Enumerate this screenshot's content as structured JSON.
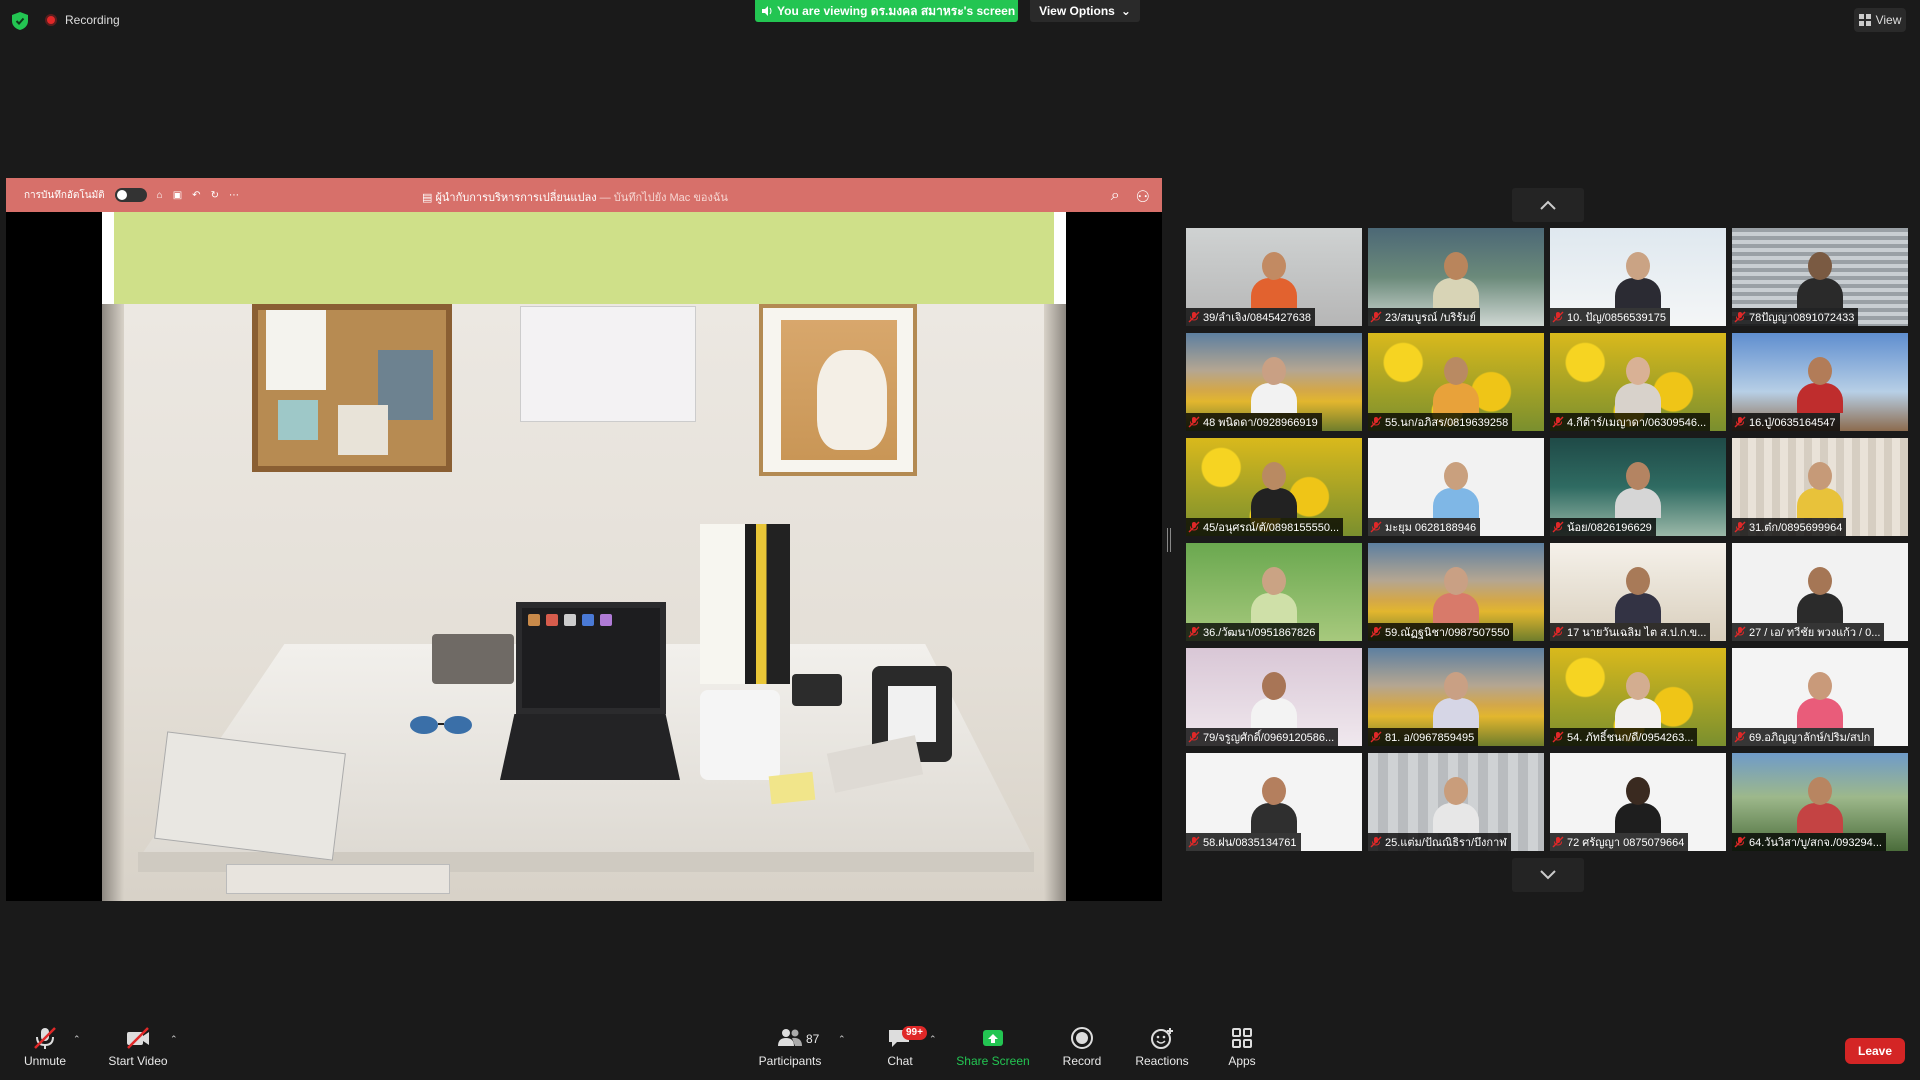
{
  "top": {
    "recording_label": "Recording",
    "banner_text": "You are viewing ดร.มงคล สมาหระ's screen",
    "view_options_label": "View Options",
    "view_label": "View"
  },
  "keynote": {
    "autosave_label": "การบันทึกอัตโนมัติ",
    "toggle_label": "ปิด",
    "document_title": "ผู้นำกับการบริหารการเปลี่ยนแปลง",
    "save_location": "— บันทึกไปยัง Mac ของฉัน"
  },
  "participants": [
    {
      "name": "39/ลำเจิง/0845427638",
      "bg": "bg-office",
      "skin": "#c28a62",
      "shirt": "#e2622f"
    },
    {
      "name": "23/สมบูรณ์ /บริรัมย์",
      "bg": "bg-room",
      "skin": "#b9855c",
      "shirt": "#d8d4b6"
    },
    {
      "name": "10. ปัญ/0856539175",
      "bg": "bg-white",
      "skin": "#caa384",
      "shirt": "#2b2b33"
    },
    {
      "name": "78ปัญญา0891072433",
      "bg": "bg-blinds",
      "skin": "#7a5a42",
      "shirt": "#2a2a2a"
    },
    {
      "name": "48 พนิดดา/0928966919",
      "bg": "bg-sunset",
      "skin": "#c9a084",
      "shirt": "#f2f2f2"
    },
    {
      "name": "55.นก/อภิสร/0819639258",
      "bg": "bg-flowers",
      "skin": "#b98a62",
      "shirt": "#e8a23a"
    },
    {
      "name": "4.กีต้าร์/เมญาดา/06309546...",
      "bg": "bg-flowers",
      "skin": "#d9b195",
      "shirt": "#d8d2cb"
    },
    {
      "name": "16.ปู่/0635164547",
      "bg": "bg-sky",
      "skin": "#b27c58",
      "shirt": "#bf2d2d"
    },
    {
      "name": "45/อนุศรณ์/ตั/0898155550...",
      "bg": "bg-flowers",
      "skin": "#b98a62",
      "shirt": "#222"
    },
    {
      "name": "มะยุม 0628188946",
      "bg": "bg-google",
      "skin": "#c9a07e",
      "shirt": "#7fb7e6"
    },
    {
      "name": "น้อย/0826196629",
      "bg": "bg-teal",
      "skin": "#b48462",
      "shirt": "#d6d6d6"
    },
    {
      "name": "31.ต๋ก/0895699964",
      "bg": "bg-curtain",
      "skin": "#c69a78",
      "shirt": "#e8c23a"
    },
    {
      "name": "36./วัฒนา/0951867826",
      "bg": "bg-green",
      "skin": "#caa384",
      "shirt": "#cfe0a8"
    },
    {
      "name": "59.ณัฏฐนิชา/0987507550",
      "bg": "bg-sunset",
      "skin": "#c9a084",
      "shirt": "#d87a6a"
    },
    {
      "name": "17 นายวันเฉลิม ไต ส.ป.ก.ข...",
      "bg": "bg-horses",
      "skin": "#a87a58",
      "shirt": "#334"
    },
    {
      "name": "27 / เอ/ ทวีชัย พวงแก้ว / 0...",
      "bg": "bg-google",
      "skin": "#a57655",
      "shirt": "#2b2b2b"
    },
    {
      "name": "79/จรูญศักดิ์/0969120586...",
      "bg": "bg-pink",
      "skin": "#a87556",
      "shirt": "#f3f3f3"
    },
    {
      "name": "81. อ/0967859495",
      "bg": "bg-sunset",
      "skin": "#c9a084",
      "shirt": "#d6d6e6"
    },
    {
      "name": "54. ภัทธิ์ชนก/ดี/0954263...",
      "bg": "bg-flowers",
      "skin": "#d3ad90",
      "shirt": "#f2f0ef"
    },
    {
      "name": "69.อภิญญาลักษ์/ปริม/สปก",
      "bg": "bg-plain",
      "skin": "#c99a7a",
      "shirt": "#e95c7a"
    },
    {
      "name": "58.ฝน/0835134761",
      "bg": "bg-plain",
      "skin": "#b47f5e",
      "shirt": "#2f2f2f"
    },
    {
      "name": "25.แต่ม/ปัณณิธิรา/บึงกาฬ",
      "bg": "bg-vblinds",
      "skin": "#c99d7b",
      "shirt": "#e7e7e7"
    },
    {
      "name": "72 ศรัญญา 0875079664",
      "bg": "bg-plain",
      "skin": "#3a2a20",
      "shirt": "#1e1e1e"
    },
    {
      "name": "64.วันวิสา/บู/สกจ./093294...",
      "bg": "bg-park",
      "skin": "#b88561",
      "shirt": "#c44343"
    }
  ],
  "toolbar": {
    "unmute": "Unmute",
    "start_video": "Start Video",
    "participants": "Participants",
    "participants_count": "87",
    "chat": "Chat",
    "chat_badge": "99+",
    "share_screen": "Share Screen",
    "record": "Record",
    "reactions": "Reactions",
    "apps": "Apps",
    "leave": "Leave"
  },
  "colors": {
    "background": "#1a1a1a",
    "share_green": "#23c552",
    "keynote_toolbar": "#d7706a",
    "leave_red": "#d42525"
  }
}
